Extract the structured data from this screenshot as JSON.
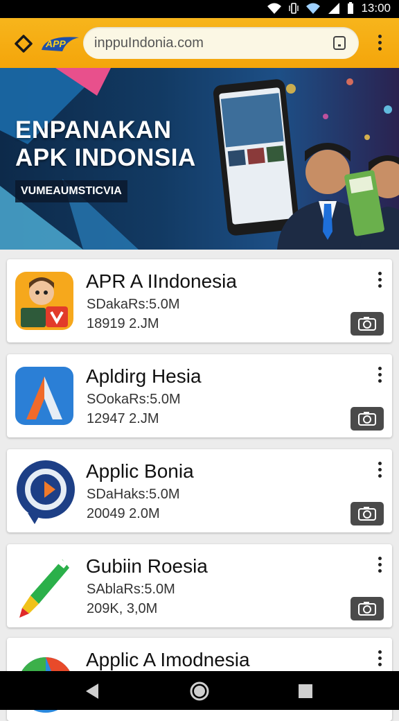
{
  "status_bar": {
    "time": "13:00"
  },
  "browser": {
    "url": "inppuIndonia.com",
    "logo_text": "APP"
  },
  "banner": {
    "title_line1": "ENPANAKAN",
    "title_line2": "APK INDONSIA",
    "tagline": "VUMEAUMSTICVIA"
  },
  "apps": [
    {
      "name": "APR A IIndonesia",
      "line1": "SDakaRs:5.0M",
      "line2": "18919 2.JM"
    },
    {
      "name": "Apldirg Hesia",
      "line1": "SOokaRs:5.0M",
      "line2": "12947 2.JM"
    },
    {
      "name": "Applic Bonia",
      "line1": "SDaHaks:5.0M",
      "line2": "20049 2.0M"
    },
    {
      "name": "Gubiin Roesia",
      "line1": "SAblaRs:5.0M",
      "line2": "209K, 3,0M"
    },
    {
      "name": "Applic A Imodnesia",
      "line1": "",
      "line2": ""
    }
  ],
  "colors": {
    "toolbar": "#f4a50a",
    "banner_bg": "#123a63",
    "screenshot_button": "#4a4a4a"
  }
}
